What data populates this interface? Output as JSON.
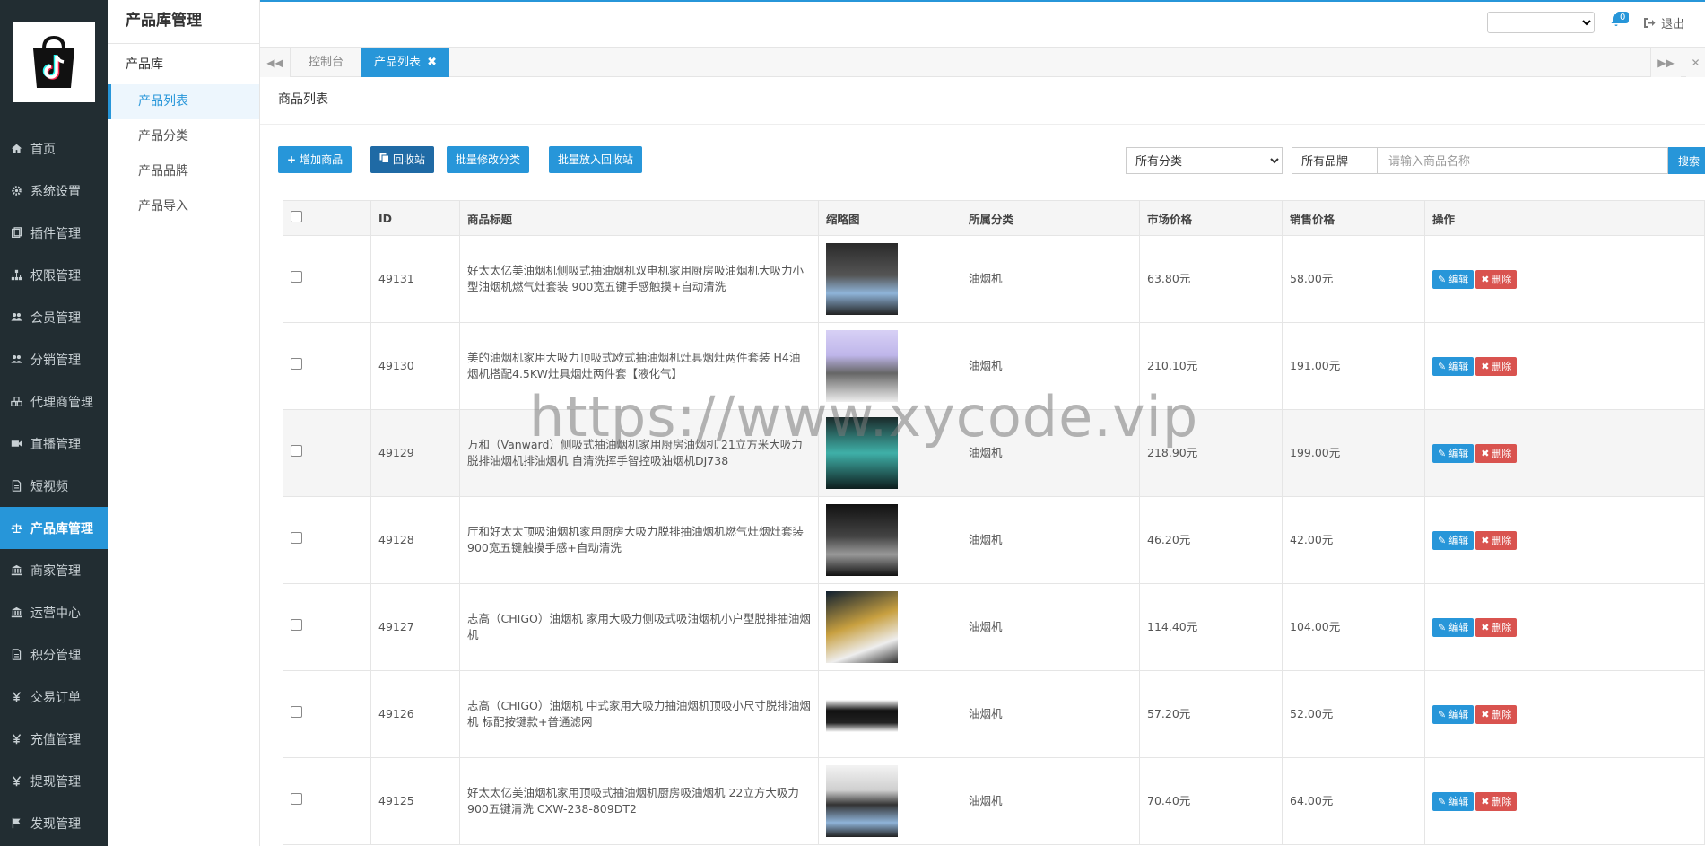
{
  "sidebar": {
    "items": [
      {
        "label": "首页",
        "icon": "home-icon"
      },
      {
        "label": "系统设置",
        "icon": "gear-icon"
      },
      {
        "label": "插件管理",
        "icon": "plugin-icon"
      },
      {
        "label": "权限管理",
        "icon": "sitemap-icon"
      },
      {
        "label": "会员管理",
        "icon": "users-icon"
      },
      {
        "label": "分销管理",
        "icon": "users-icon"
      },
      {
        "label": "代理商管理",
        "icon": "cubes-icon"
      },
      {
        "label": "直播管理",
        "icon": "video-icon"
      },
      {
        "label": "短视频",
        "icon": "file-icon"
      },
      {
        "label": "产品库管理",
        "icon": "scale-icon"
      },
      {
        "label": "商家管理",
        "icon": "bank-icon"
      },
      {
        "label": "运营中心",
        "icon": "bank-icon"
      },
      {
        "label": "积分管理",
        "icon": "file-icon"
      },
      {
        "label": "交易订单",
        "icon": "yen-icon"
      },
      {
        "label": "充值管理",
        "icon": "yen-icon"
      },
      {
        "label": "提现管理",
        "icon": "yen-icon"
      },
      {
        "label": "发现管理",
        "icon": "flag-icon"
      }
    ]
  },
  "subsidebar": {
    "title": "产品库管理",
    "group": "产品库",
    "items": [
      "产品列表",
      "产品分类",
      "产品品牌",
      "产品导入"
    ]
  },
  "topbar": {
    "notification_count": "0",
    "logout_label": "退出"
  },
  "tabs": {
    "items": [
      "控制台",
      "产品列表"
    ]
  },
  "content": {
    "title": "商品列表",
    "toolbar": {
      "add_label": "增加商品",
      "recycle_label": "回收站",
      "batch_category_label": "批量修改分类",
      "batch_recycle_label": "批量放入回收站",
      "category_select": "所有分类",
      "brand_select": "所有品牌",
      "search_placeholder": "请输入商品名称",
      "search_label": "搜索"
    },
    "table": {
      "headers": [
        "ID",
        "商品标题",
        "缩略图",
        "所属分类",
        "市场价格",
        "销售价格",
        "操作"
      ],
      "edit_label": "编辑",
      "delete_label": "删除",
      "rows": [
        {
          "id": "49131",
          "title": "好太太亿美油烟机侧吸式抽油烟机双电机家用厨房吸油烟机大吸力小型油烟机燃气灶套装 900宽五键手感触摸+自动清洗",
          "category": "油烟机",
          "market_price": "63.80元",
          "sale_price": "58.00元"
        },
        {
          "id": "49130",
          "title": "美的油烟机家用大吸力顶吸式欧式抽油烟机灶具烟灶两件套装 H4油烟机搭配4.5KW灶具烟灶两件套【液化气】",
          "category": "油烟机",
          "market_price": "210.10元",
          "sale_price": "191.00元"
        },
        {
          "id": "49129",
          "title": "万和（Vanward）侧吸式抽油烟机家用厨房油烟机 21立方米大吸力脱排油烟机排油烟机 自清洗挥手智控吸油烟机DJ738",
          "category": "油烟机",
          "market_price": "218.90元",
          "sale_price": "199.00元"
        },
        {
          "id": "49128",
          "title": "厅和好太太顶吸油烟机家用厨房大吸力脱排抽油烟机燃气灶烟灶套装 900宽五键触摸手感+自动清洗",
          "category": "油烟机",
          "market_price": "46.20元",
          "sale_price": "42.00元"
        },
        {
          "id": "49127",
          "title": "志高（CHIGO）油烟机 家用大吸力侧吸式吸油烟机小户型脱排抽油烟机",
          "category": "油烟机",
          "market_price": "114.40元",
          "sale_price": "104.00元"
        },
        {
          "id": "49126",
          "title": "志高（CHIGO）油烟机 中式家用大吸力抽油烟机顶吸小尺寸脱排油烟机 标配按键款+普通滤网",
          "category": "油烟机",
          "market_price": "57.20元",
          "sale_price": "52.00元"
        },
        {
          "id": "49125",
          "title": "好太太亿美油烟机家用顶吸式抽油烟机厨房吸油烟机 22立方大吸力 900五键清洗 CXW-238-809DT2",
          "category": "油烟机",
          "market_price": "70.40元",
          "sale_price": "64.00元"
        }
      ]
    }
  },
  "watermark": "https://www.xycode.vip"
}
